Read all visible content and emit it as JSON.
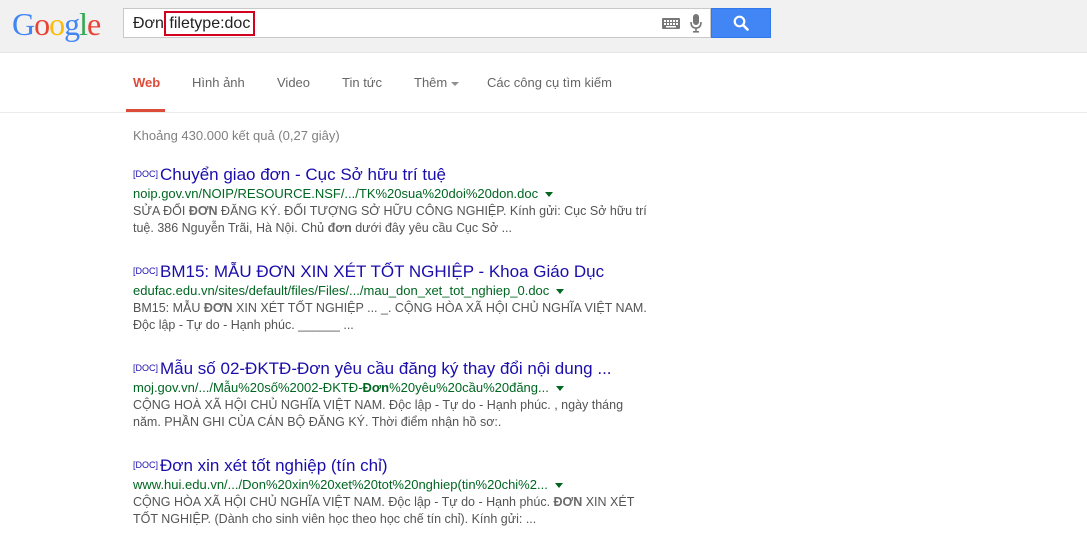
{
  "header": {
    "logo": [
      "G",
      "o",
      "o",
      "g",
      "l",
      "e"
    ],
    "logo_colors": [
      "#4285f4",
      "#ea4335",
      "#fbbc05",
      "#4285f4",
      "#34a853",
      "#ea4335"
    ],
    "query_prefix": "Đơn ",
    "query_highlight": "filetype:doc"
  },
  "tabs": {
    "web": "Web",
    "images": "Hình ảnh",
    "video": "Video",
    "news": "Tin tức",
    "more": "Thêm",
    "tools": "Các công cụ tìm kiếm"
  },
  "stats": "Khoảng 430.000 kết quả (0,27 giây)",
  "doc_tag": "[DOC]",
  "results": [
    {
      "title": "Chuyển giao đơn - Cục Sở hữu trí tuệ",
      "url": "noip.gov.vn/NOIP/RESOURCE.NSF/.../TK%20sua%20doi%20don.doc",
      "snippet_1": "SỬA ĐỔI ",
      "snippet_bold_1": "ĐƠN",
      "snippet_2": " ĐĂNG KÝ. ĐỐI TƯỢNG SỞ HỮU CÔNG NGHIỆP. Kính gửi: Cục Sở hữu trí tuệ. 386 Nguyễn Trãi, Hà Nội. Chủ ",
      "snippet_bold_2": "đơn",
      "snippet_3": " dưới đây yêu cầu Cục Sở ..."
    },
    {
      "title": "BM15: MẪU ĐƠN XIN XÉT TỐT NGHIỆP - Khoa Giáo Dục",
      "url": "edufac.edu.vn/sites/default/files/Files/.../mau_don_xet_tot_nghiep_0.doc",
      "snippet_1": "BM15: MẪU ",
      "snippet_bold_1": "ĐƠN",
      "snippet_2": " XIN XÉT TỐT NGHIỆP ... _. CỘNG HÒA XÃ HỘI CHỦ NGHĨA VIỆT NAM. Độc lập - Tự do - Hạnh phúc. ______ ..."
    },
    {
      "title": "Mẫu số 02-ĐKTĐ-Đơn yêu cầu đăng ký thay đổi nội dung ...",
      "url_1": "moj.gov.vn/.../Mẫu%20số%2002-ĐKTĐ-",
      "url_bold": "Đơn",
      "url_2": "%20yêu%20cầu%20đăng...",
      "snippet_1": "CỘNG HOÀ XÃ HỘI CHỦ NGHĨA VIỆT NAM. Độc lập - Tự do - Hạnh phúc. , ngày tháng năm. PHẦN GHI CỦA CÁN BỘ ĐĂNG KÝ. Thời điểm nhận hồ sơ:."
    },
    {
      "title": "Đơn xin xét tốt nghiệp (tín chỉ)",
      "url": "www.hui.edu.vn/.../Don%20xin%20xet%20tot%20nghiep(tin%20chi%2...",
      "snippet_1": "CỘNG HÒA XÃ HỘI CHỦ NGHĨA VIỆT NAM. Độc lập - Tự do - Hạnh phúc. ",
      "snippet_bold_1": "ĐƠN",
      "snippet_2": " XIN XÉT TỐT NGHIỆP. (Dành cho sinh viên học theo học chế tín chỉ). Kính gửi: ..."
    }
  ]
}
